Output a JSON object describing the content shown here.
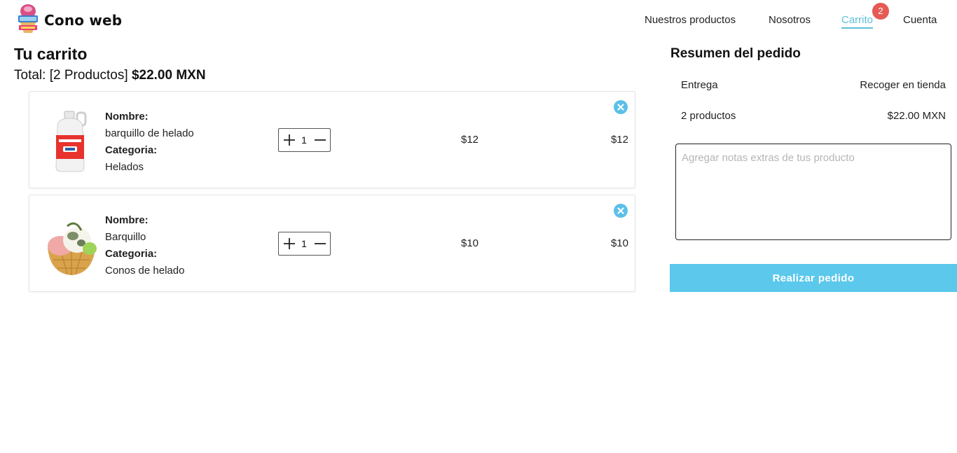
{
  "brand": {
    "name": "Cono web",
    "logo_icon": "cone-logo-icon"
  },
  "nav": {
    "items": [
      "Nuestros productos",
      "Nosotros",
      "Carrito",
      "Cuenta"
    ],
    "active": "Carrito",
    "cart_badge": "2"
  },
  "cart": {
    "title": "Tu carrito",
    "total_prefix": "Total: [2 Productos]",
    "total_amount": "$22.00 MXN",
    "name_label": "Nombre:",
    "category_label": "Categoria:",
    "items": [
      {
        "name": "barquillo de helado",
        "category": "Helados",
        "quantity": "1",
        "price": "$12",
        "subtotal": "$12",
        "image_icon": "jug-product-image"
      },
      {
        "name": "Barquillo",
        "category": "Conos de helado",
        "quantity": "1",
        "price": "$10",
        "subtotal": "$10",
        "image_icon": "ice-cream-cup-image"
      }
    ]
  },
  "summary": {
    "title": "Resumen del pedido",
    "delivery_label": "Entrega",
    "delivery_value": "Recoger en tienda",
    "products_label": "2 productos",
    "products_value": "$22.00 MXN",
    "notes_placeholder": "Agregar notas extras de tus producto",
    "order_button": "Realizar pedido"
  },
  "colors": {
    "accent": "#5bc8ec",
    "badge": "#e55a55"
  }
}
